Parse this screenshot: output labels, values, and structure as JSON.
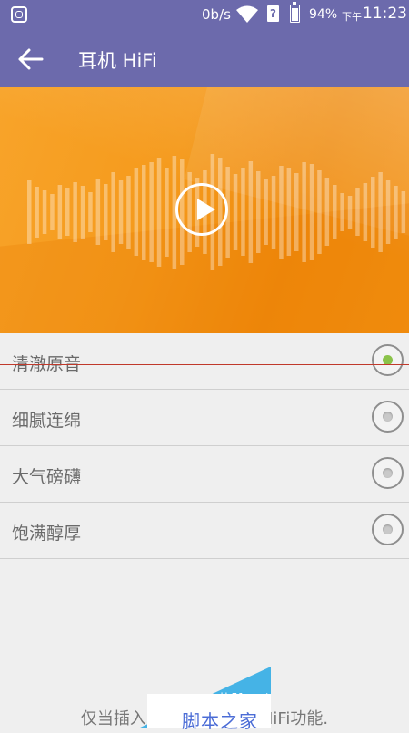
{
  "status_bar": {
    "net_speed": "0b/s",
    "sim_label": "?",
    "battery_percent": "94%",
    "battery_level": 0.94,
    "ampm": "下午",
    "time": "11:23"
  },
  "app_bar": {
    "title": "耳机 HiFi",
    "back_icon": "arrow-left-icon"
  },
  "hero": {
    "play_icon": "play-icon",
    "colors": {
      "primary": "#f59a1c",
      "accent": "#ffffff"
    }
  },
  "modes": [
    {
      "label": "清澈原音",
      "selected": true
    },
    {
      "label": "细腻连绵",
      "selected": false
    },
    {
      "label": "大气磅礴",
      "selected": false
    },
    {
      "label": "饱满醇厚",
      "selected": false
    }
  ],
  "footer": {
    "note_start": "仅当插入",
    "note_end": "HiFi功能."
  },
  "watermark": {
    "site": "jb51.net",
    "name": "脚本之家"
  },
  "colors": {
    "app_bar": "#6c6aac",
    "selected_radio": "#8bc34a",
    "background": "#efefef"
  }
}
